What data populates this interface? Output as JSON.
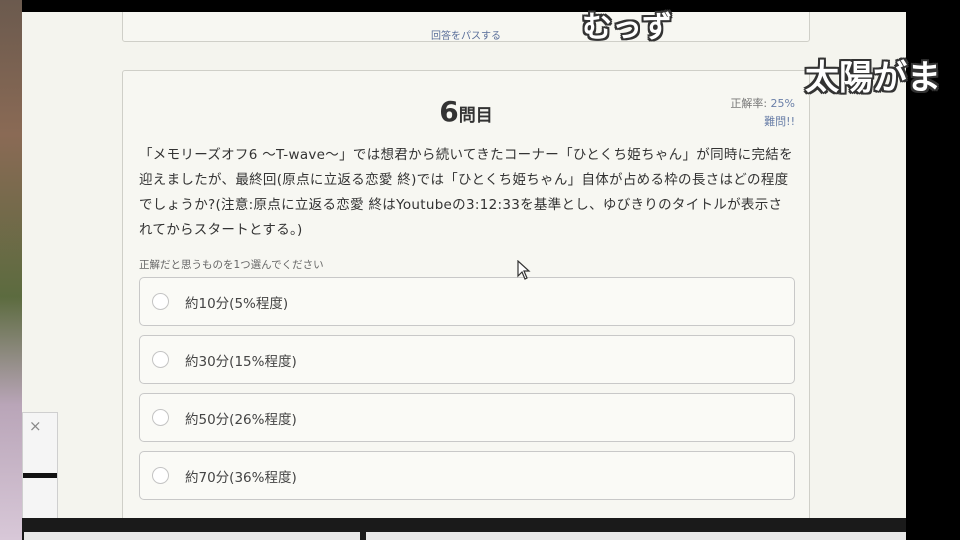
{
  "prev_card": {
    "pass_link": "回答をパスする"
  },
  "question": {
    "number": "6",
    "suffix": "問目",
    "accuracy_label": "正解率:",
    "accuracy_value": "25%",
    "difficulty": "難問!!",
    "text": "「メモリーズオフ6 〜T-wave〜」では想君から続いてきたコーナー「ひとくち姫ちゃん」が同時に完結を迎えましたが、最終回(原点に立返る恋愛 終)では「ひとくち姫ちゃん」自体が占める枠の長さはどの程度でしょうか?(注意:原点に立返る恋愛 終はYoutubeの3:12:33を基準とし、ゆびきりのタイトルが表示されてからスタートとする。)",
    "instruction": "正解だと思うものを1つ選んでください",
    "options": [
      {
        "label": "約10分(5%程度)"
      },
      {
        "label": "約30分(15%程度)"
      },
      {
        "label": "約50分(26%程度)"
      },
      {
        "label": "約70分(36%程度)"
      }
    ]
  },
  "popup": {
    "close": "×"
  },
  "comments": [
    "むっず",
    "太陽がま"
  ]
}
